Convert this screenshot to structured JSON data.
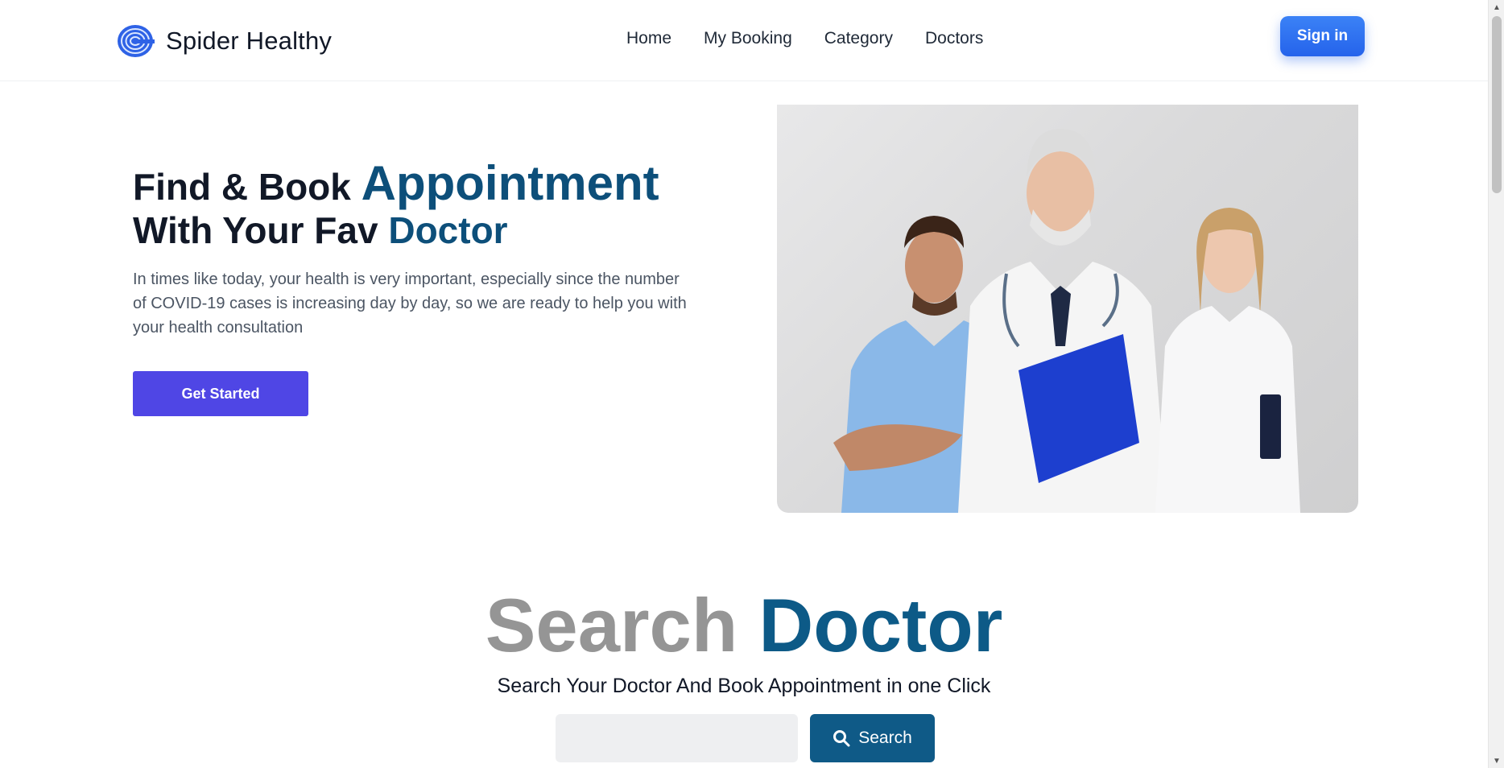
{
  "header": {
    "brand_name": "Spider Healthy",
    "nav": [
      "Home",
      "My Booking",
      "Category",
      "Doctors"
    ],
    "signin_label": "Sign in"
  },
  "hero": {
    "title_part1": "Find & Book ",
    "title_highlight1": "Appointment",
    "title_part2": "With Your Fav ",
    "title_highlight2": "Doctor",
    "description": "In times like today, your health is very important, especially since the number of COVID-19 cases is increasing day by day, so we are ready to help you with your health consultation",
    "cta_label": "Get Started"
  },
  "search": {
    "heading_word1": "Search",
    "heading_word2": "Doctor",
    "subtitle": "Search Your Doctor And Book Appointment in one Click",
    "input_value": "",
    "button_label": "Search"
  },
  "colors": {
    "accent": "#0d4f7a",
    "signin": "#2563eb",
    "cta": "#4f46e5",
    "search_button": "#0f5a87"
  },
  "icons": {
    "brand": "spiral-logo-icon",
    "search_button": "magnifier-icon"
  }
}
